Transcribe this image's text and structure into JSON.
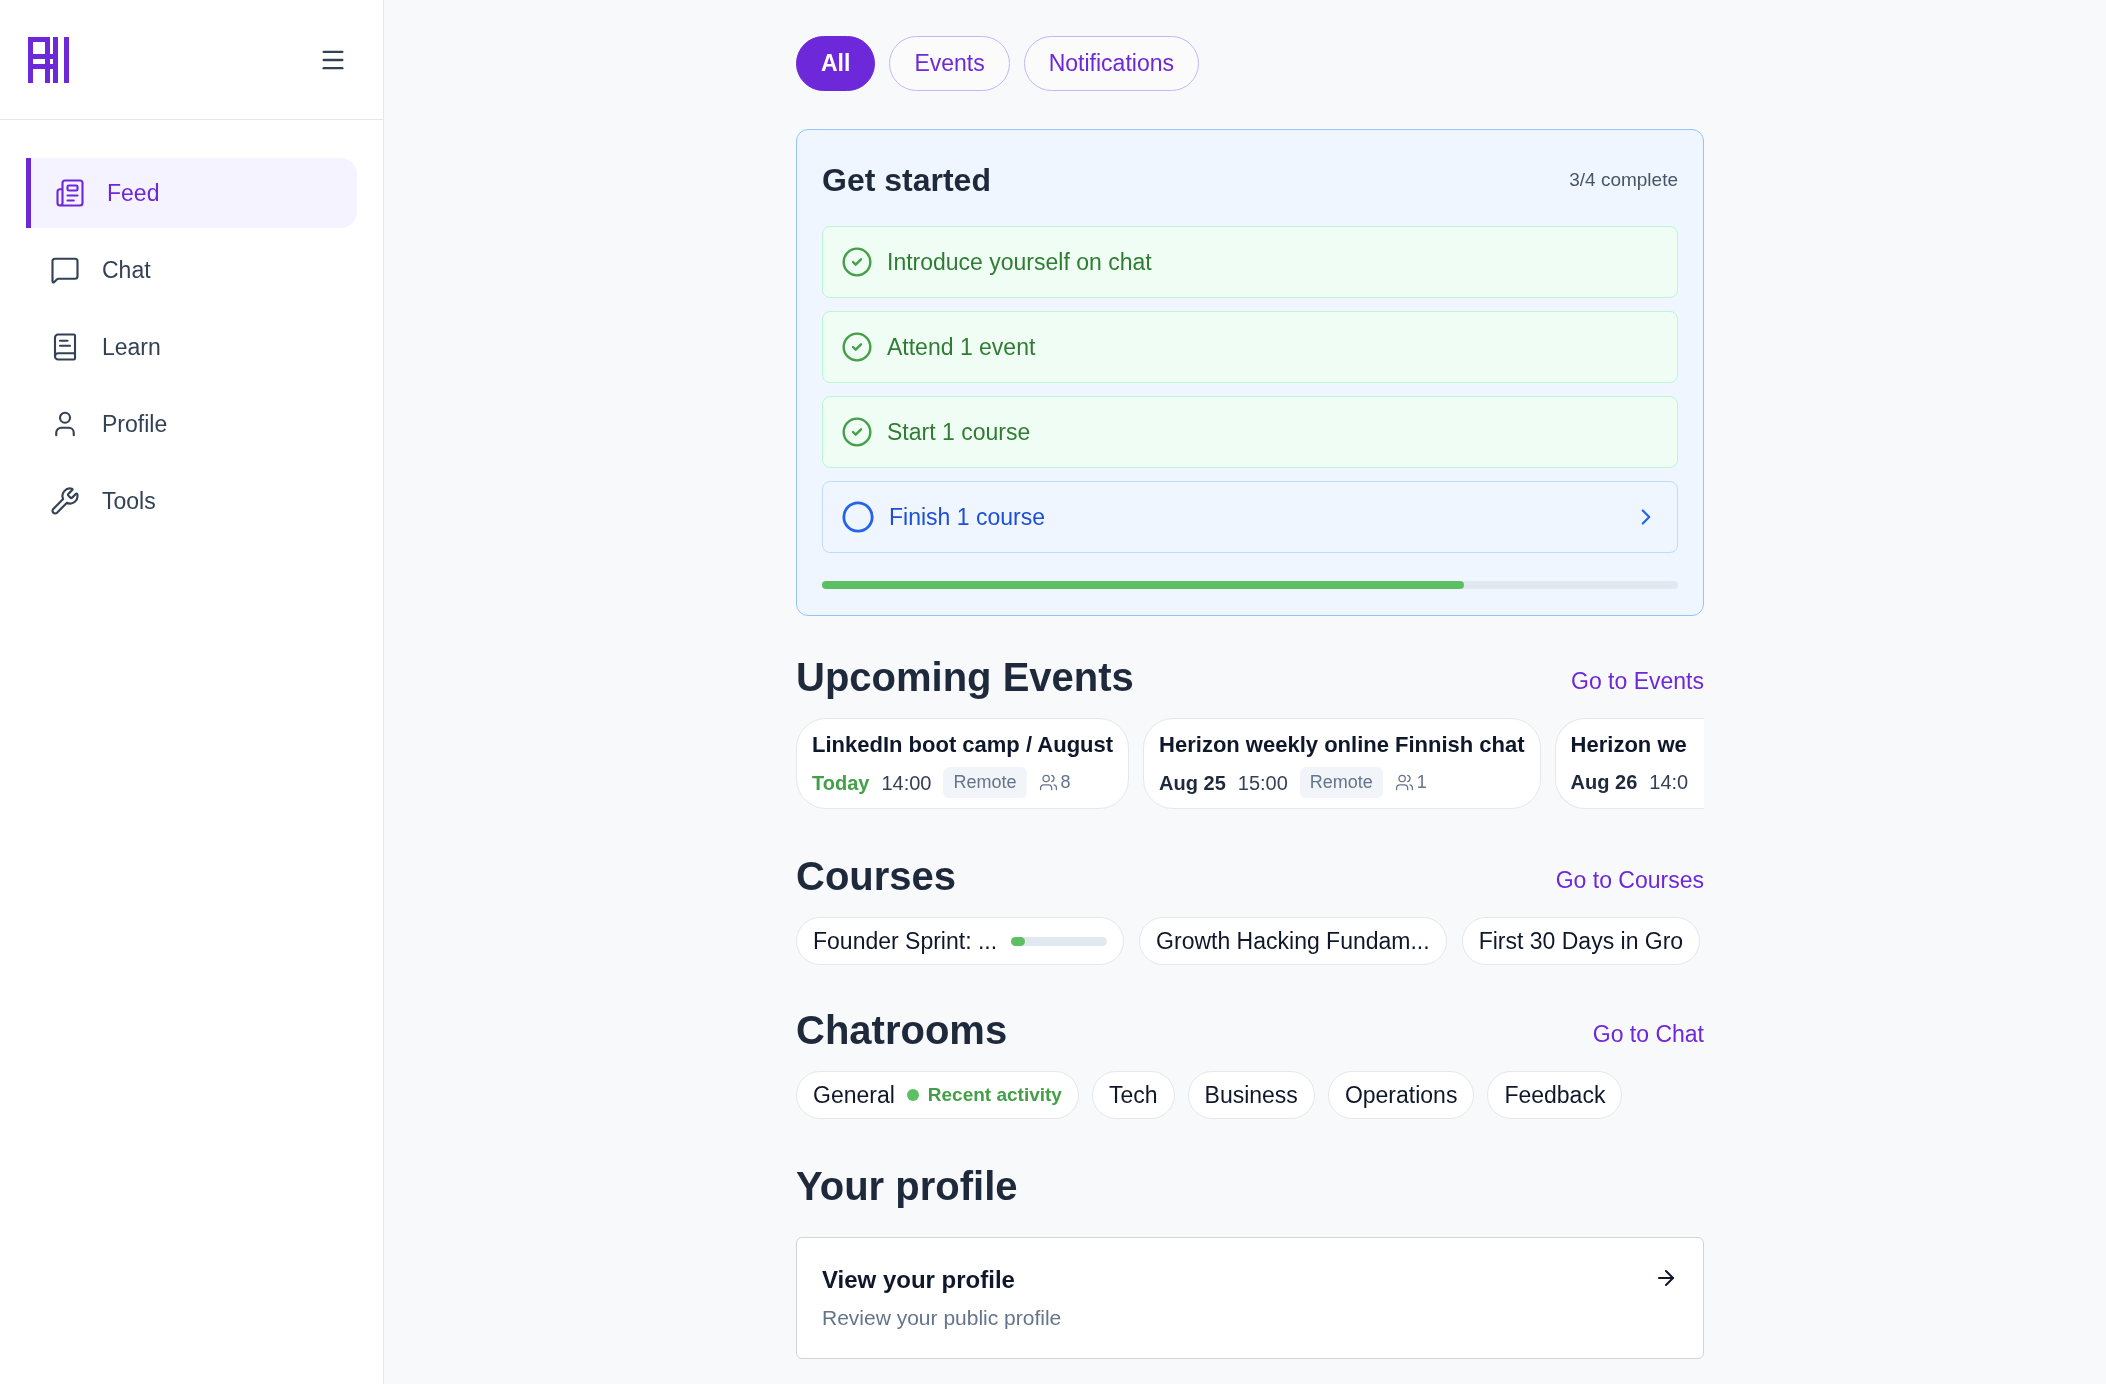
{
  "sidebar": {
    "items": [
      {
        "label": "Feed",
        "kind": "feed",
        "selected": true
      },
      {
        "label": "Chat",
        "kind": "chat",
        "selected": false
      },
      {
        "label": "Learn",
        "kind": "learn",
        "selected": false
      },
      {
        "label": "Profile",
        "kind": "profile",
        "selected": false
      },
      {
        "label": "Tools",
        "kind": "tools",
        "selected": false
      }
    ]
  },
  "tabs": [
    {
      "label": "All",
      "selected": true
    },
    {
      "label": "Events",
      "selected": false
    },
    {
      "label": "Notifications",
      "selected": false
    }
  ],
  "get_started": {
    "title": "Get started",
    "count": "3/4 complete",
    "level": 0.75,
    "tasks": [
      {
        "label": "Introduce yourself on chat",
        "checked": true
      },
      {
        "label": "Attend 1 event",
        "checked": true
      },
      {
        "label": "Start 1 course",
        "checked": true
      },
      {
        "label": "Finish 1 course",
        "checked": false
      }
    ]
  },
  "events": {
    "title": "Upcoming Events",
    "link": "Go to Events",
    "items": [
      {
        "title": "LinkedIn boot camp / August",
        "date": "Today",
        "today": true,
        "time": "14:00",
        "tag": "Remote",
        "attendees": "8"
      },
      {
        "title": "Herizon weekly online Finnish chat",
        "date": "Aug 25",
        "today": false,
        "time": "15:00",
        "tag": "Remote",
        "attendees": "1"
      },
      {
        "title": "Herizon we",
        "date": "Aug 26",
        "today": false,
        "time": "14:0"
      }
    ]
  },
  "courses": {
    "title": "Courses",
    "link": "Go to Courses",
    "items": [
      {
        "title": "Founder Sprint: ...",
        "level": 0.15
      },
      {
        "title": "Growth Hacking Fundam..."
      },
      {
        "title": "First 30 Days in Gro"
      }
    ]
  },
  "chatrooms": {
    "title": "Chatrooms",
    "link": "Go to Chat",
    "items": [
      {
        "name": "General",
        "activity": "Recent activity"
      },
      {
        "name": "Tech"
      },
      {
        "name": "Business"
      },
      {
        "name": "Operations"
      },
      {
        "name": "Feedback"
      }
    ]
  },
  "profile": {
    "title": "Your profile",
    "card_title": "View your profile",
    "card_subtitle": "Review your public profile"
  }
}
